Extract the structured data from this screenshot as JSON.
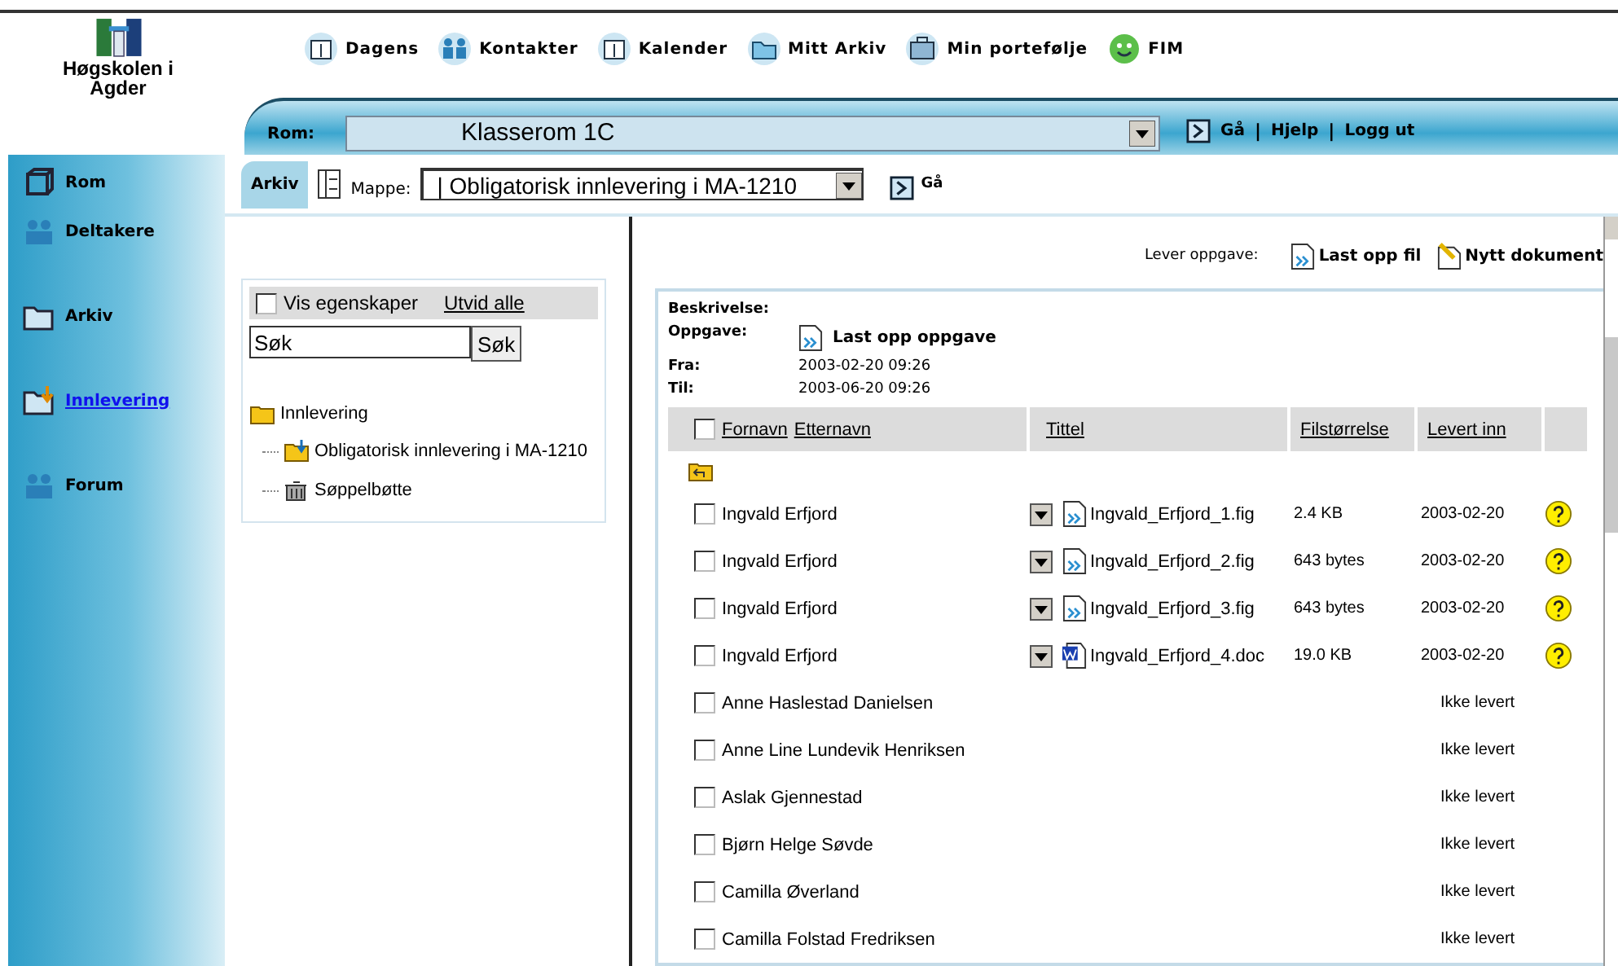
{
  "logo": {
    "text": "Høgskolen i Agder"
  },
  "top_nav": [
    {
      "label": "Dagens"
    },
    {
      "label": "Kontakter"
    },
    {
      "label": "Kalender"
    },
    {
      "label": "Mitt Arkiv"
    },
    {
      "label": "Min portefølje"
    },
    {
      "label": "FIM"
    }
  ],
  "room_bar": {
    "label": "Rom:",
    "value": "Klasserom 1C",
    "go": "Gå",
    "separator": "|",
    "links": [
      "Hjelp",
      "Logg ut"
    ]
  },
  "sidebar": {
    "items": [
      {
        "label": "Rom",
        "selected": false
      },
      {
        "label": "Deltakere",
        "selected": false
      },
      {
        "label": "Arkiv",
        "selected": false
      },
      {
        "label": "Innlevering",
        "selected": true
      },
      {
        "label": "Forum",
        "selected": false
      }
    ]
  },
  "toolbar": {
    "tab": "Arkiv",
    "folder_label": "Mappe:",
    "folder_value": "| Obligatorisk innlevering i MA-1210",
    "go": "Gå"
  },
  "tree_panel": {
    "show_properties": {
      "label": "Vis egenskaper",
      "checked": false
    },
    "expand_all": "Utvid alle",
    "search_value": "Søk",
    "search_button": "Søk",
    "tree": [
      {
        "label": "Innlevering",
        "children": [
          {
            "label": "Obligatorisk innlevering i MA-1210"
          },
          {
            "label": "Søppelbøtte"
          }
        ]
      }
    ]
  },
  "submit_bar": {
    "label": "Lever oppgave:",
    "actions": [
      {
        "label": "Last opp fil"
      },
      {
        "label": "Nytt dokument"
      }
    ]
  },
  "assignment": {
    "description_label": "Beskrivelse:",
    "task_label": "Oppgave:",
    "task_link": "Last opp oppgave",
    "from_label": "Fra:",
    "from": "2003-02-20 09:26",
    "to_label": "Til:",
    "to": "2003-06-20 09:26"
  },
  "table": {
    "select_all": false,
    "columns": [
      "Fornavn",
      "Etternavn",
      "Tittel",
      "Filstørrelse",
      "Levert inn"
    ],
    "rows": [
      {
        "kind": "file",
        "checked": false,
        "name": "Ingvald Erfjord",
        "file": "Ingvald_Erfjord_1.fig",
        "size": "2.4 KB",
        "delivered": "2003-02-20"
      },
      {
        "kind": "file",
        "checked": false,
        "name": "Ingvald Erfjord",
        "file": "Ingvald_Erfjord_2.fig",
        "size": "643 bytes",
        "delivered": "2003-02-20"
      },
      {
        "kind": "file",
        "checked": false,
        "name": "Ingvald Erfjord",
        "file": "Ingvald_Erfjord_3.fig",
        "size": "643 bytes",
        "delivered": "2003-02-20"
      },
      {
        "kind": "word",
        "checked": false,
        "name": "Ingvald Erfjord",
        "file": "Ingvald_Erfjord_4.doc",
        "size": "19.0 KB",
        "delivered": "2003-02-20"
      },
      {
        "kind": "missing",
        "checked": false,
        "name": "Anne Haslestad Danielsen",
        "delivered": "Ikke levert"
      },
      {
        "kind": "missing",
        "checked": false,
        "name": "Anne Line Lundevik Henriksen",
        "delivered": "Ikke levert"
      },
      {
        "kind": "missing",
        "checked": false,
        "name": "Aslak Gjennestad",
        "delivered": "Ikke levert"
      },
      {
        "kind": "missing",
        "checked": false,
        "name": "Bjørn Helge Søvde",
        "delivered": "Ikke levert"
      },
      {
        "kind": "missing",
        "checked": false,
        "name": "Camilla Øverland",
        "delivered": "Ikke levert"
      },
      {
        "kind": "missing",
        "checked": false,
        "name": "Camilla Folstad Fredriksen",
        "delivered": "Ikke levert"
      }
    ]
  }
}
